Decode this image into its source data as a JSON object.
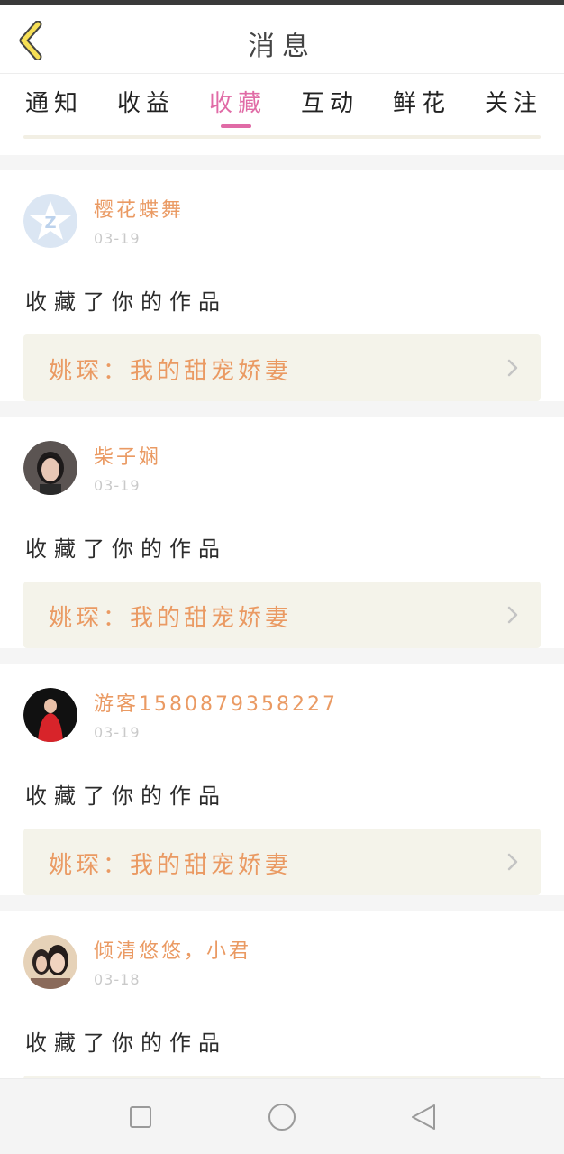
{
  "header": {
    "title": "消息",
    "back_icon": "chevron-left-icon"
  },
  "tabs": [
    {
      "label": "通知",
      "active": false
    },
    {
      "label": "收益",
      "active": false
    },
    {
      "label": "收藏",
      "active": true
    },
    {
      "label": "互动",
      "active": false
    },
    {
      "label": "鲜花",
      "active": false
    },
    {
      "label": "关注",
      "active": false
    }
  ],
  "colors": {
    "accent": "#e06ba6",
    "name": "#ea9a63",
    "card_link_bg": "#f4f3ea"
  },
  "messages": [
    {
      "username": "樱花蝶舞",
      "date": "03-19",
      "action": "收藏了你的作品",
      "work": "姚琛：我的甜宠娇妻",
      "avatar": "default-qq-avatar"
    },
    {
      "username": "柴子娴",
      "date": "03-19",
      "action": "收藏了你的作品",
      "work": "姚琛：我的甜宠娇妻",
      "avatar": "photo-avatar"
    },
    {
      "username": "游客1580879358227",
      "date": "03-19",
      "action": "收藏了你的作品",
      "work": "姚琛：我的甜宠娇妻",
      "avatar": "photo-avatar"
    },
    {
      "username": "倾清悠悠，小君",
      "date": "03-18",
      "action": "收藏了你的作品",
      "work": "",
      "avatar": "photo-avatar"
    }
  ],
  "navbar": {
    "items": [
      "square-icon",
      "circle-icon",
      "triangle-back-icon"
    ]
  }
}
